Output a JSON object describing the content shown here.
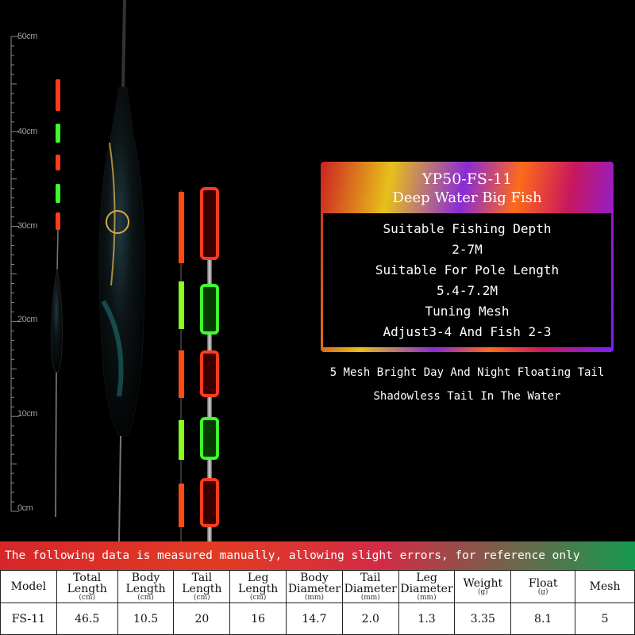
{
  "ruler": {
    "labels": [
      "50cm",
      "40cm",
      "30cm",
      "20cm",
      "10cm",
      "0cm"
    ]
  },
  "title_panel": {
    "model": "YP50-FS-11",
    "subtitle": "Deep Water Big Fish",
    "lines": [
      "Suitable Fishing Depth",
      "2-7M",
      "Suitable For Pole Length",
      "5.4-7.2M",
      "Tuning Mesh",
      "Adjust3-4 And Fish 2-3"
    ]
  },
  "features": [
    "5 Mesh Bright Day And Night Floating Tail",
    "Shadowless Tail In The Water"
  ],
  "note": "The following data is measured manually, allowing slight errors, for reference only",
  "table": {
    "headers": [
      {
        "label": "Model",
        "unit": ""
      },
      {
        "label": "Total Length",
        "unit": "(cm)"
      },
      {
        "label": "Body Length",
        "unit": "(cm)"
      },
      {
        "label": "Tail Length",
        "unit": "(cm)"
      },
      {
        "label": "Leg Length",
        "unit": "(cm)"
      },
      {
        "label": "Body Diameter",
        "unit": "(mm)"
      },
      {
        "label": "Tail Diameter",
        "unit": "(mm)"
      },
      {
        "label": "Leg Diameter",
        "unit": "(mm)"
      },
      {
        "label": "Weight",
        "unit": "(g)"
      },
      {
        "label": "Float",
        "unit": "(g)"
      },
      {
        "label": "Mesh",
        "unit": ""
      }
    ],
    "row": [
      "FS-11",
      "46.5",
      "10.5",
      "20",
      "16",
      "14.7",
      "2.0",
      "1.3",
      "3.35",
      "8.1",
      "5"
    ]
  },
  "colors": {
    "tail_red": "#ff3b1a",
    "tail_green": "#3cff2a",
    "ruler": "#9a9a9a"
  }
}
